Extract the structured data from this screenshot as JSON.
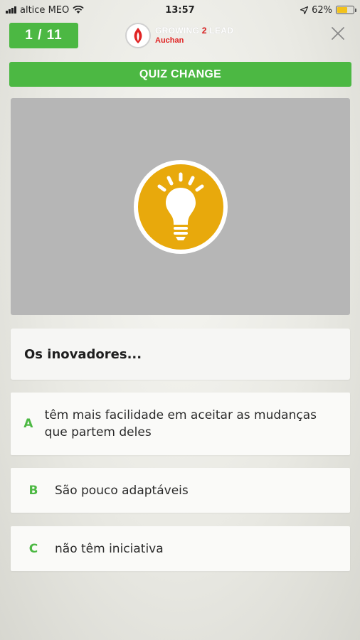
{
  "status_bar": {
    "carrier": "altice MEO",
    "time": "13:57",
    "battery": "62%",
    "battery_level": 0.62
  },
  "header": {
    "progress": "1 / 11",
    "logo": {
      "title_prefix": "GROWING ",
      "title_number": "2",
      "title_suffix": " LEAD",
      "subtitle": "Auchan"
    }
  },
  "quiz": {
    "title": "QUIZ CHANGE",
    "image_icon": "lightbulb-icon",
    "question": "Os inovadores...",
    "answers": [
      {
        "letter": "A",
        "text": "têm mais facilidade em aceitar as mudanças que partem deles"
      },
      {
        "letter": "B",
        "text": "São pouco adaptáveis"
      },
      {
        "letter": "C",
        "text": "não têm iniciativa"
      }
    ]
  },
  "colors": {
    "accent_green": "#4cb843",
    "bulb_orange": "#e8a90c",
    "brand_red": "#e02424",
    "image_bg": "#b6b6b6"
  }
}
